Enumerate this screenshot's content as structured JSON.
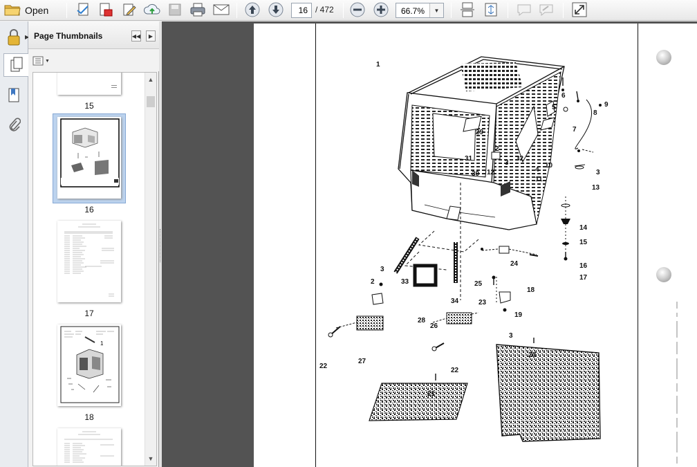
{
  "toolbar": {
    "open_label": "Open",
    "current_page": "16",
    "total_pages": "/ 472",
    "zoom": "66.7%"
  },
  "panel": {
    "title": "Page Thumbnails",
    "thumbnails": [
      {
        "label": "15"
      },
      {
        "label": "16",
        "selected": true
      },
      {
        "label": "17"
      },
      {
        "label": "18"
      }
    ]
  },
  "drawing": {
    "part_numbers": [
      "1",
      "2",
      "3",
      "4",
      "5",
      "6",
      "7",
      "8",
      "9",
      "10",
      "11",
      "12",
      "13",
      "14",
      "15",
      "16",
      "17",
      "18",
      "19",
      "20",
      "21",
      "22",
      "23",
      "24",
      "25",
      "26",
      "27",
      "28",
      "29",
      "30",
      "31",
      "32",
      "33",
      "34"
    ]
  },
  "icons": [
    "open-folder-icon",
    "print-icon",
    "email-icon",
    "prev-page-icon",
    "next-page-icon",
    "zoom-out-icon",
    "zoom-in-icon",
    "lock-icon",
    "thumbnails-icon",
    "bookmarks-icon",
    "attachments-icon"
  ],
  "colors": {
    "doc_background": "#535353",
    "selection": "#bcd3ee",
    "panel": "#f2f2f2"
  }
}
